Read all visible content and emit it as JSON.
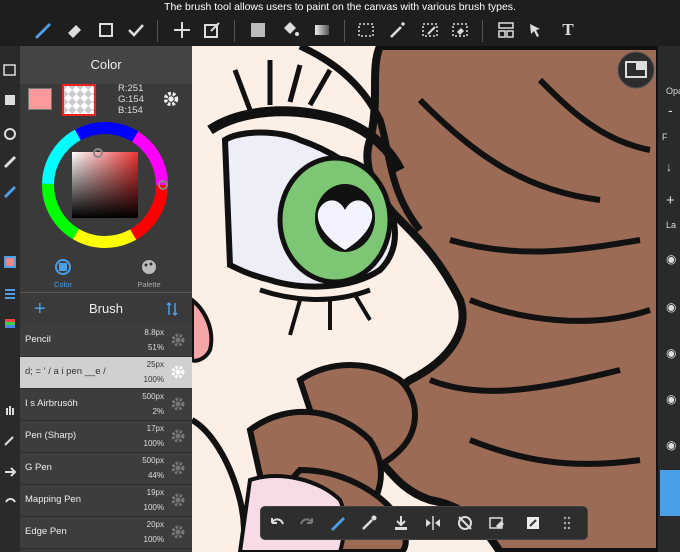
{
  "caption": "The brush tool allows users to paint on the canvas with various brush types.",
  "color_panel": {
    "title": "Color",
    "r": "R:251",
    "g": "G:154",
    "b": "B:154",
    "main_color": "#fb9a9a",
    "tabs": [
      {
        "label": "Color",
        "active": true
      },
      {
        "label": "Palette",
        "active": false
      }
    ]
  },
  "brush_panel": {
    "title": "Brush",
    "items": [
      {
        "name": "Pencil",
        "size": "8.8px",
        "opacity": "51%",
        "selected": false
      },
      {
        "name": "d; = ' / a i pen __e /",
        "size": "25px",
        "opacity": "100%",
        "selected": true
      },
      {
        "name": "I s Airbrusóh",
        "size": "500px",
        "opacity": "2%",
        "selected": false
      },
      {
        "name": "Pen (Sharp)",
        "size": "17px",
        "opacity": "100%",
        "selected": false
      },
      {
        "name": "G Pen",
        "size": "500px",
        "opacity": "44%",
        "selected": false
      },
      {
        "name": "Mapping Pen",
        "size": "19px",
        "opacity": "100%",
        "selected": false
      },
      {
        "name": "Edge Pen",
        "size": "20px",
        "opacity": "100%",
        "selected": false
      }
    ]
  },
  "right_panel": {
    "opacity_label": "Opa",
    "layer_label": "La",
    "minus": "-",
    "plus": "+",
    "f_label": "F"
  },
  "icons": {
    "top": [
      "brush-icon",
      "eraser-icon",
      "rectangle-icon",
      "checkmark-icon",
      "move-icon",
      "transform-icon",
      "fill-color-icon",
      "bucket-icon",
      "gradient-icon",
      "select-rect-icon",
      "magic-wand-icon",
      "select-pen-icon",
      "select-eraser-icon",
      "layout-icon",
      "select-arrow-icon",
      "text-icon"
    ],
    "bottom": [
      "undo-icon",
      "redo-icon",
      "brush-icon",
      "eyedropper-icon",
      "import-icon",
      "flip-icon",
      "no-rotate-icon",
      "eraser-icon",
      "export-icon",
      "grid-icon"
    ]
  },
  "colors": {
    "accent": "#4a9fe8",
    "canvas_skin": "#fcefe6",
    "hair": "#9b6b55",
    "eye_green": "#7cc674",
    "blush": "#f4a5a5"
  }
}
